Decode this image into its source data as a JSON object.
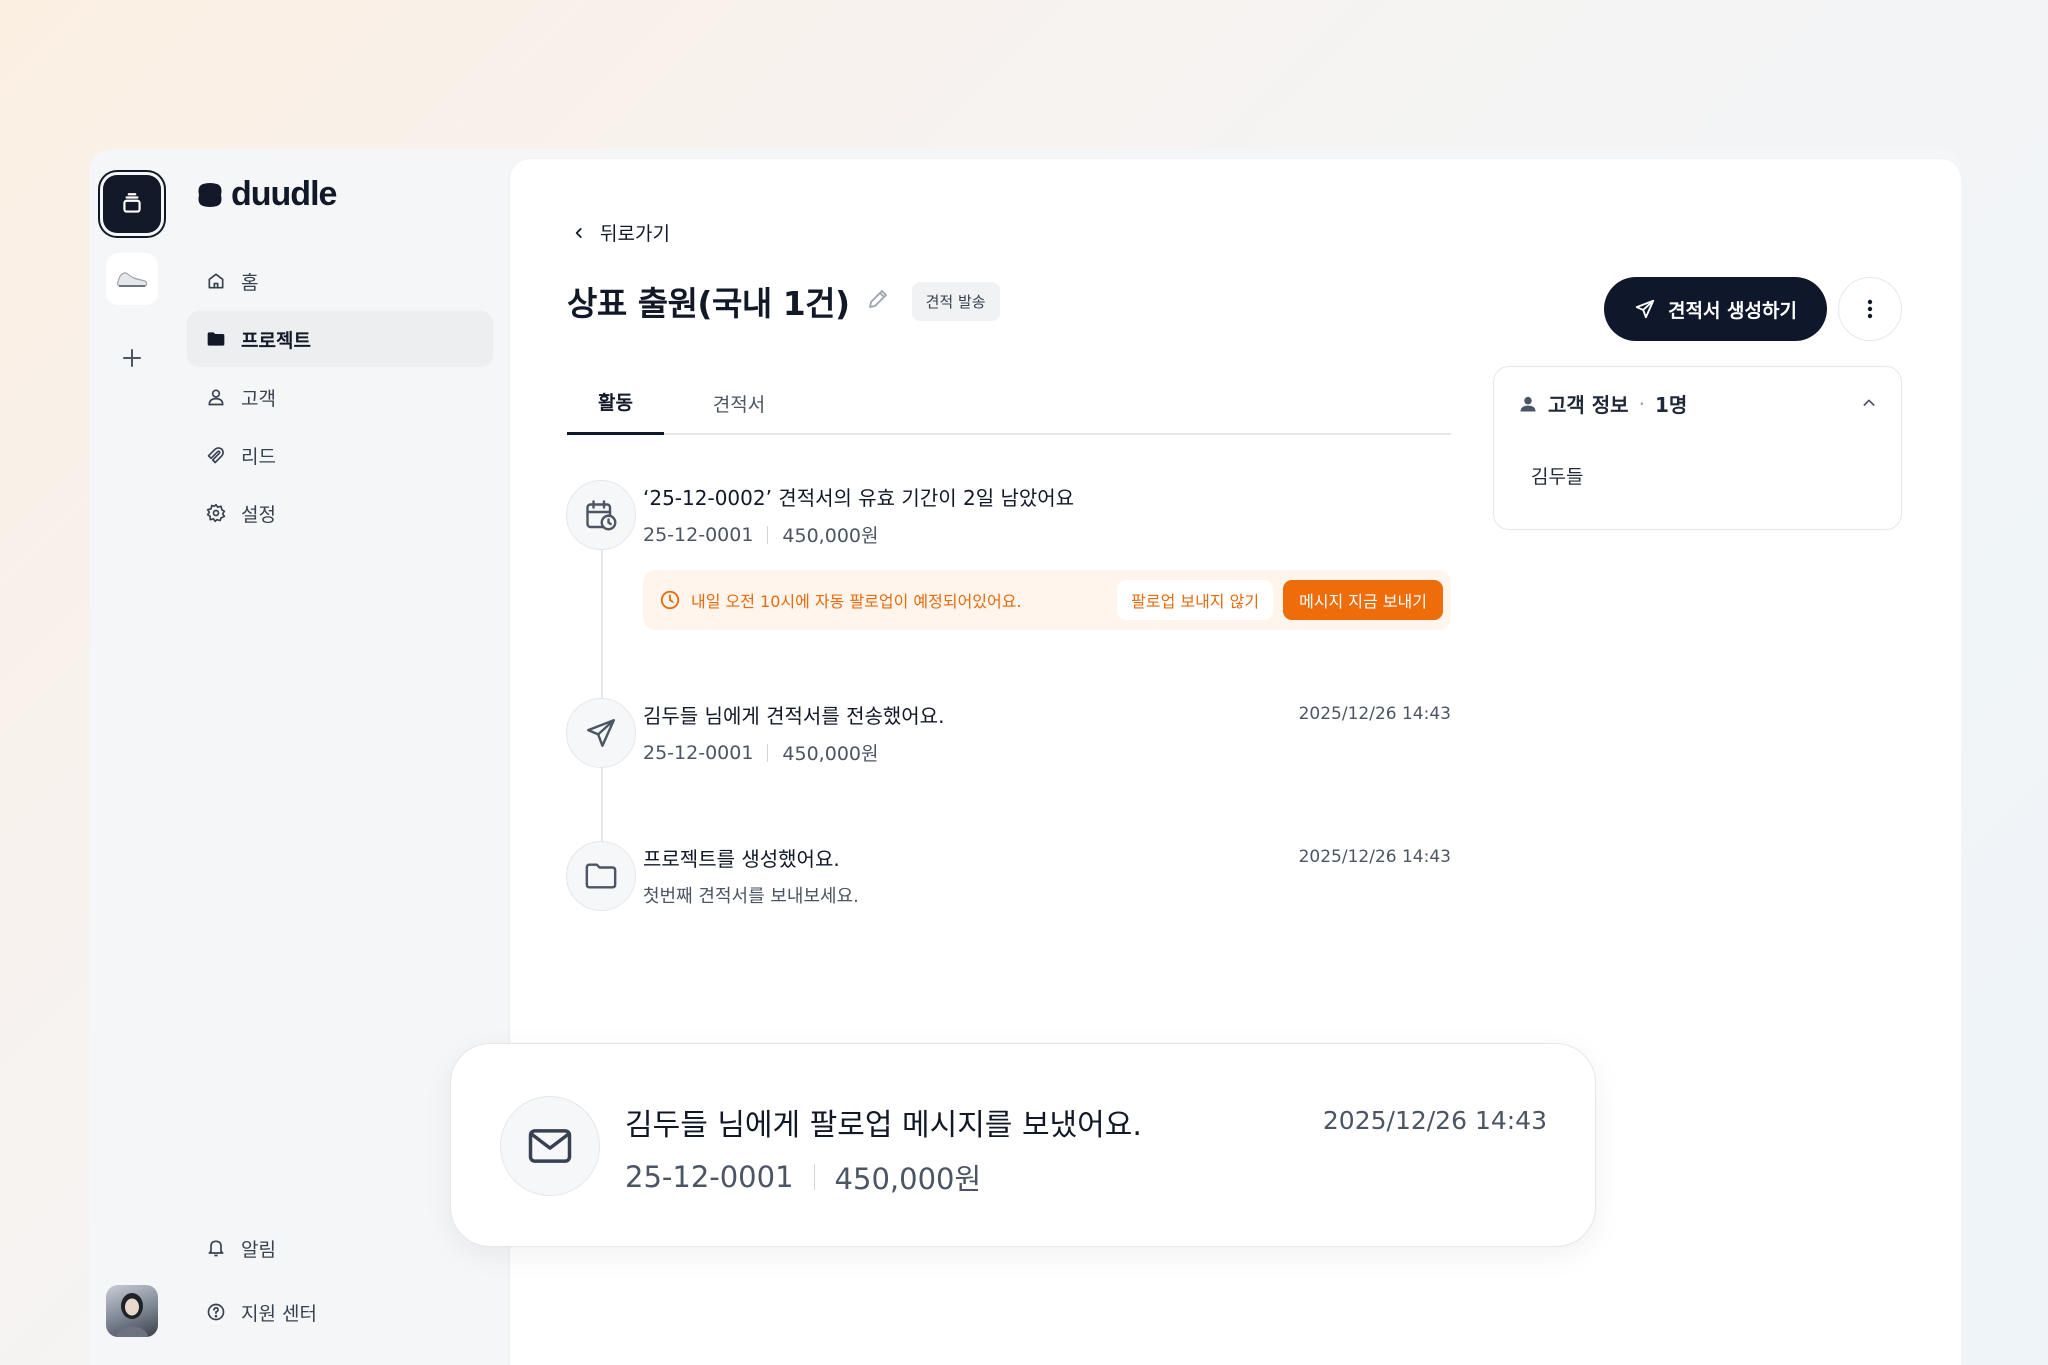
{
  "brand": {
    "name": "duudle"
  },
  "sidebar": {
    "items": [
      {
        "label": "홈",
        "icon": "home-icon"
      },
      {
        "label": "프로젝트",
        "icon": "folder-icon",
        "active": true
      },
      {
        "label": "고객",
        "icon": "user-icon"
      },
      {
        "label": "리드",
        "icon": "magnet-icon"
      },
      {
        "label": "설정",
        "icon": "gear-icon"
      }
    ],
    "bottom": [
      {
        "label": "알림",
        "icon": "bell-icon"
      },
      {
        "label": "지원 센터",
        "icon": "help-icon"
      }
    ]
  },
  "header": {
    "back_label": "뒤로가기",
    "title": "상표 출원(국내 1건)",
    "status_badge": "견적 발송",
    "primary_action": "견적서 생성하기"
  },
  "tabs": [
    {
      "label": "활동",
      "active": true
    },
    {
      "label": "견적서",
      "active": false
    }
  ],
  "timeline": [
    {
      "icon": "calendar-clock-icon",
      "title": "‘25-12-0002’ 견적서의 유효 기간이 2일 남았어요",
      "code": "25-12-0001",
      "amount": "450,000원",
      "alert": {
        "text": "내일 오전 10시에 자동 팔로업이 예정되어있어요.",
        "secondary": "팔로업 보내지 않기",
        "primary": "메시지 지금 보내기"
      }
    },
    {
      "icon": "send-icon",
      "title": "김두들 님에게 견적서를 전송했어요.",
      "code": "25-12-0001",
      "amount": "450,000원",
      "time": "2025/12/26 14:43"
    },
    {
      "icon": "folder-icon",
      "title": "프로젝트를 생성했어요.",
      "subtitle": "첫번째 견적서를 보내보세요.",
      "time": "2025/12/26 14:43"
    }
  ],
  "customer_panel": {
    "title": "고객 정보",
    "count": "1명",
    "names": [
      "김두들"
    ]
  },
  "floating_card": {
    "icon": "mail-icon",
    "title": "김두들 님에게 팔로업 메시지를 보냈어요.",
    "code": "25-12-0001",
    "amount": "450,000원",
    "time": "2025/12/26 14:43"
  },
  "colors": {
    "accent_orange": "#ef6c0b",
    "alert_bg": "#fff5ec",
    "primary_dark": "#0f172a"
  }
}
